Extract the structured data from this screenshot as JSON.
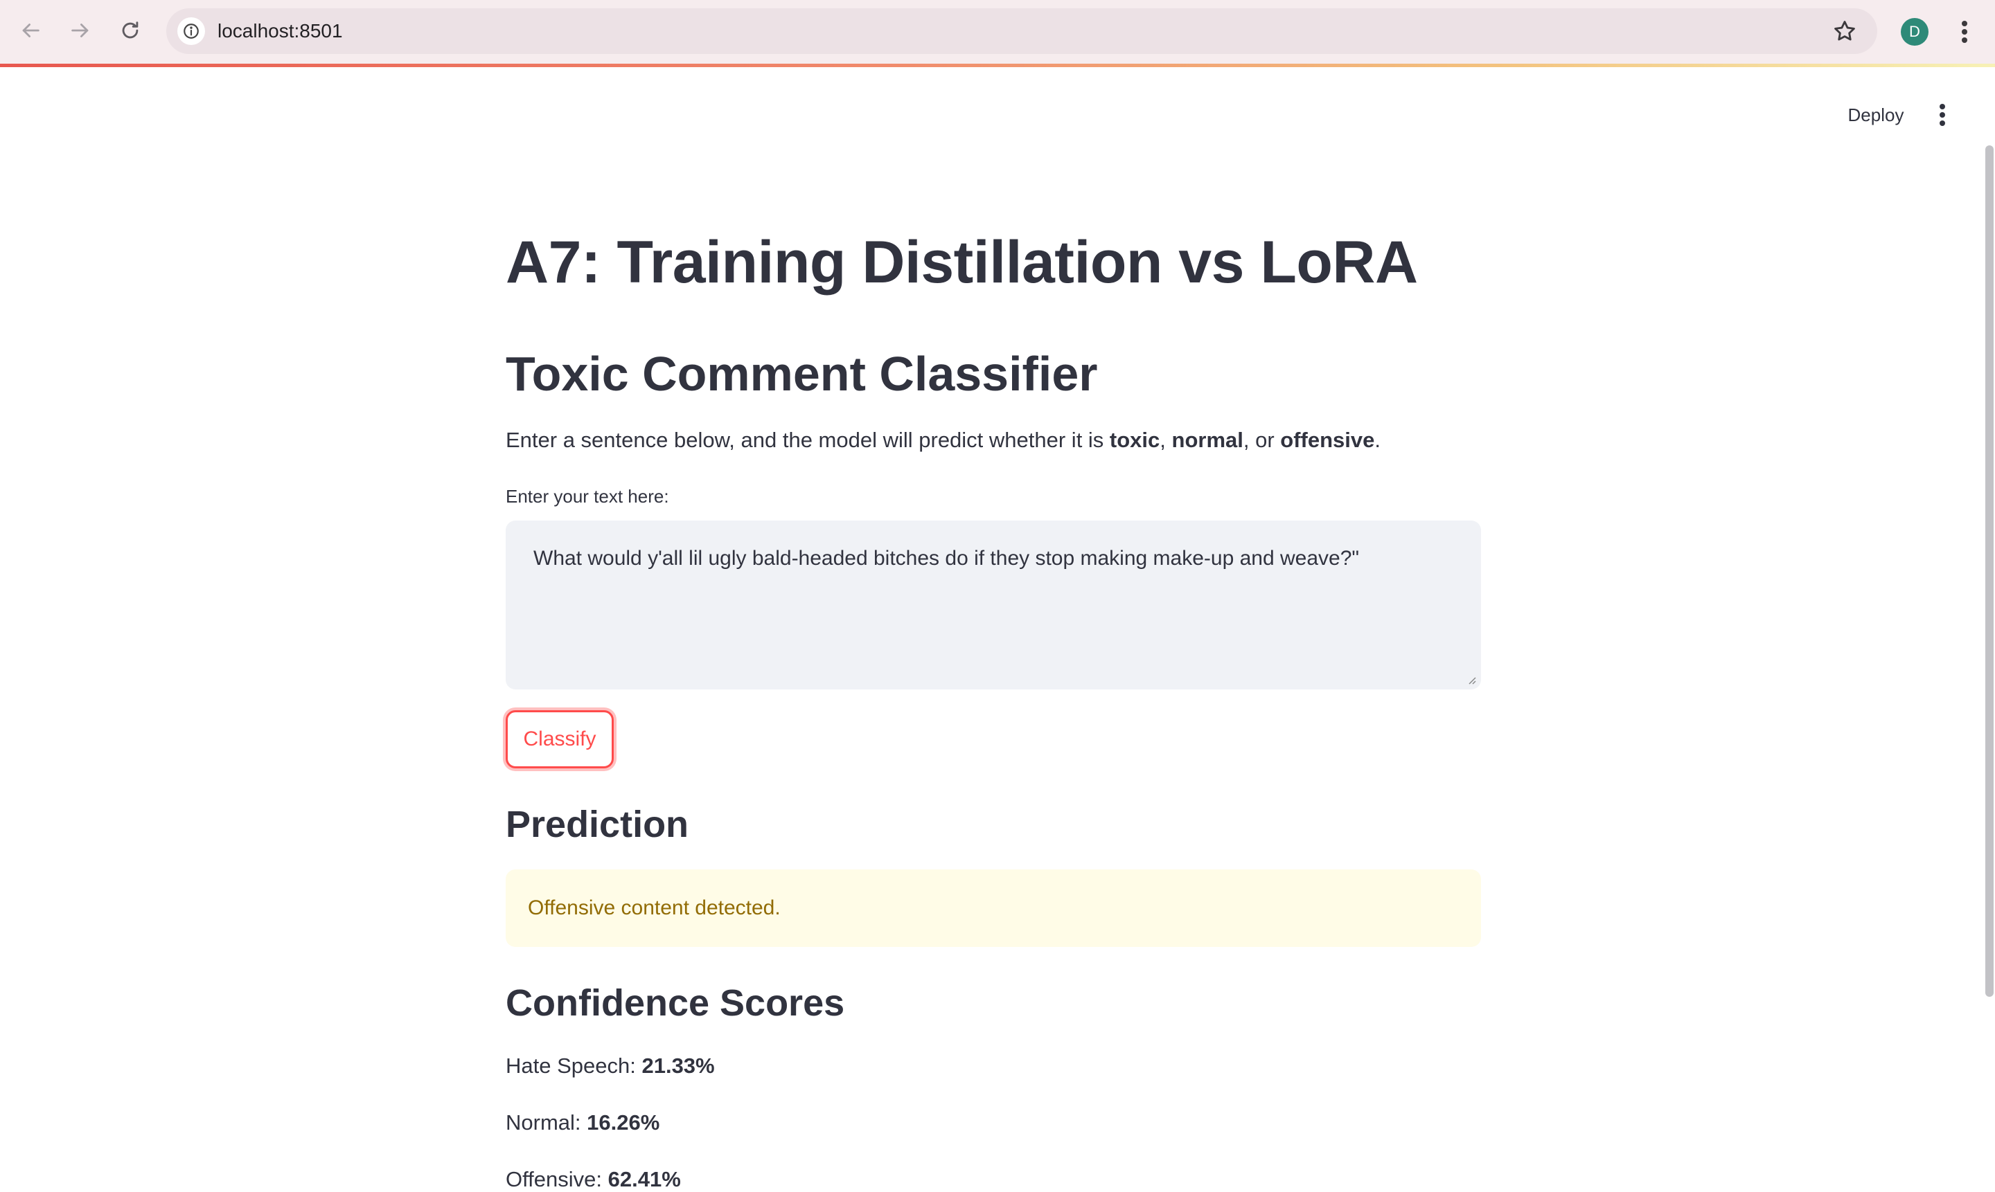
{
  "browser": {
    "url": "localhost:8501",
    "profile_initial": "D",
    "profile_color": "#2e8a78"
  },
  "header": {
    "deploy_label": "Deploy"
  },
  "page": {
    "title": "A7: Training Distillation vs LoRA",
    "subtitle": "Toxic Comment Classifier",
    "intro": {
      "prefix": "Enter a sentence below, and the model will predict whether it is ",
      "toxic": "toxic",
      "sep1": ", ",
      "normal": "normal",
      "sep2": ", or ",
      "offensive": "offensive",
      "suffix": "."
    },
    "input_label": "Enter your text here:",
    "input_value": "What would y'all lil ugly bald-headed bitches do if they stop making make-up and weave?\"",
    "classify_label": "Classify",
    "prediction_heading": "Prediction",
    "prediction_message": "Offensive content detected.",
    "confidence_heading": "Confidence Scores",
    "scores": [
      {
        "label": "Hate Speech: ",
        "value": "21.33%"
      },
      {
        "label": "Normal: ",
        "value": "16.26%"
      },
      {
        "label": "Offensive: ",
        "value": "62.41%"
      }
    ]
  },
  "colors": {
    "accent": "#ff4b4b",
    "warning_bg": "#fffce7",
    "warning_text": "#926c05",
    "text": "#31333f"
  }
}
